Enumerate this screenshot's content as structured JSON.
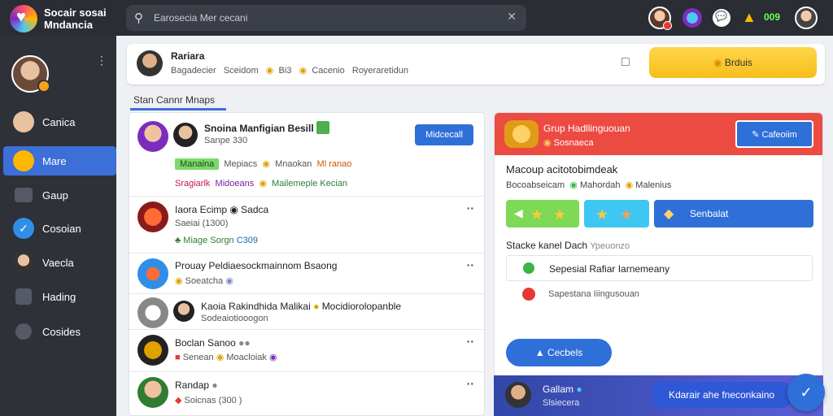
{
  "app": {
    "brand_line1": "Socair sosai",
    "brand_line2": "Mndancia"
  },
  "search": {
    "placeholder": "Earosecia Mer cecani"
  },
  "topbar": {
    "count": "009"
  },
  "sidebar": {
    "items": [
      {
        "label": "Canica",
        "icon": "profile-icon",
        "color": "#e8c2a0"
      },
      {
        "label": "Mare",
        "icon": "emoji-icon",
        "color": "#ffb703"
      },
      {
        "label": "Gaup",
        "icon": "monitor-icon",
        "color": "#555a66"
      },
      {
        "label": "Cosoian",
        "icon": "check-icon",
        "color": "#2f8fe8"
      },
      {
        "label": "Vaecla",
        "icon": "avatar-icon",
        "color": "#e8c2a0"
      },
      {
        "label": "Hading",
        "icon": "calendar-icon",
        "color": "#555a66"
      },
      {
        "label": "Cosides",
        "icon": "lock-icon",
        "color": "#555a66"
      }
    ]
  },
  "composer": {
    "name": "Rariara",
    "meta_a": "Bagadecier",
    "meta_b": "Sceidom",
    "meta_c": "Bi3",
    "meta_d": "Cacenio",
    "meta_e": "Royeraretidun",
    "button_label": "Brduis"
  },
  "section_tab": "Stan Cannr Mnaps",
  "feed": {
    "posts": [
      {
        "title": "Snoina Manfigian Besill",
        "sub": "Sanpe 330",
        "pill": "Manaina",
        "tag_a": "Mepiacs",
        "tag_b": "Mnaokan",
        "tag_b_num": "Ml",
        "tag_b_word": "ranao",
        "line3_a": "Sragiarlk",
        "line3_b": "Midoeans",
        "line3_c": "Mailemeple Kecian",
        "button": "Midcecall"
      },
      {
        "title": "Iaora Ecimp",
        "title_b": "Sadca",
        "sub": "Saeiai (1300)",
        "sub2_a": "Miage",
        "sub2_b": "Sorgn",
        "sub2_num": "C309"
      },
      {
        "title": "Prouay Peldiaesockmainnom Bsaong",
        "sub": "Soeatcha"
      },
      {
        "title": "Kaoia Rakindhida Malikai",
        "title_b": "Mocidiorolopanble",
        "sub": "Sodeaiotiooogon"
      },
      {
        "title": "Boclan",
        "title_b": "Sanoo",
        "sub": "Senean",
        "sub_b": "Moacloiak"
      },
      {
        "title": "Randap",
        "sub": "Soicnas",
        "sub_b": "(300 )"
      }
    ]
  },
  "panel": {
    "head_title": "Grup Hadllinguouan",
    "head_sub": "Sosnaeca",
    "head_button": "Cafeoiim",
    "title": "Macoup acitotobimdeak",
    "meta_a": "Bocoabseicam",
    "meta_b": "Mahordah",
    "meta_c": "Malenius",
    "tile_button": "Senbalat",
    "section": "Stacke kanel Dach",
    "section_b": "Ypeuonzo",
    "row1": "Sepesial Rafiar Iarnemeany",
    "row2": "Sapestana Iiingusouan",
    "cta": "Cecbels"
  },
  "bottom": {
    "name": "Gallam",
    "sub": "Slsiecera",
    "pill": "Kdarair ahe fneconkaino"
  }
}
